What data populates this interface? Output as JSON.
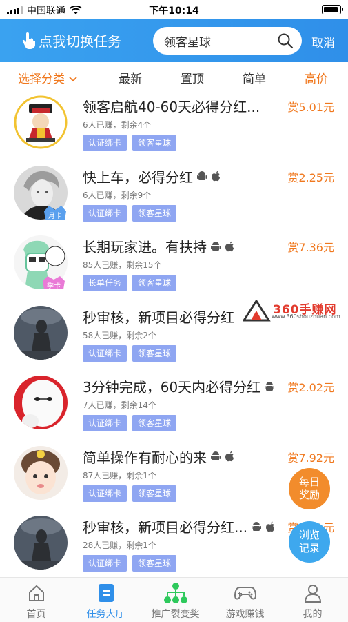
{
  "status_bar": {
    "carrier": "中国联通",
    "time": "下午10:14"
  },
  "header": {
    "switch_label": "点我切换任务",
    "search_value": "领客星球",
    "cancel_label": "取消"
  },
  "filters": {
    "category": "选择分类",
    "latest": "最新",
    "pinned": "置顶",
    "simple": "简单",
    "high_price": "高价"
  },
  "tasks": [
    {
      "title": "领客启航40-60天必得分红...",
      "reward": "赏5.01元",
      "meta": "6人已赚，剩余4个",
      "tags": [
        "认证绑卡",
        "领客星球"
      ],
      "badge": ""
    },
    {
      "title": "快上车，必得分红",
      "reward": "赏2.25元",
      "meta": "6人已赚，剩余9个",
      "tags": [
        "认证绑卡",
        "领客星球"
      ],
      "badge": "月卡"
    },
    {
      "title": "长期玩家进。有扶持",
      "reward": "赏7.36元",
      "meta": "85人已赚，剩余15个",
      "tags": [
        "长单任务",
        "领客星球"
      ],
      "badge": "季卡"
    },
    {
      "title": "秒审核，新项目必得分红",
      "reward": "",
      "meta": "58人已赚，剩余2个",
      "tags": [
        "认证绑卡",
        "领客星球"
      ],
      "badge": ""
    },
    {
      "title": "3分钟完成，60天内必得分红",
      "reward": "赏2.02元",
      "meta": "7人已赚，剩余14个",
      "tags": [
        "认证绑卡",
        "领客星球"
      ],
      "badge": ""
    },
    {
      "title": "简单操作有耐心的来",
      "reward": "赏7.92元",
      "meta": "87人已赚，剩余1个",
      "tags": [
        "认证绑卡",
        "领客星球"
      ],
      "badge": ""
    },
    {
      "title": "秒审核，新项目必得分红...",
      "reward": "赏5.01元",
      "meta": "28人已赚，剩余1个",
      "tags": [
        "认证绑卡",
        "领客星球"
      ],
      "badge": ""
    }
  ],
  "floating": {
    "daily": [
      "每日",
      "奖励"
    ],
    "history": [
      "浏览",
      "记录"
    ]
  },
  "watermark": {
    "title": "360手赚网",
    "url": "www.360shouzhuan.com"
  },
  "bottom_nav": [
    {
      "label": "首页",
      "icon": "home-icon"
    },
    {
      "label": "任务大厅",
      "icon": "task-hall-icon"
    },
    {
      "label": "推广裂变奖",
      "icon": "network-icon"
    },
    {
      "label": "游戏赚钱",
      "icon": "gamepad-icon"
    },
    {
      "label": "我的",
      "icon": "user-icon"
    }
  ],
  "colors": {
    "header_blue": "#3aa2f0",
    "accent_orange": "#f0781e",
    "tag_blue": "#8fa6f2",
    "nav_active": "#2f8fe9"
  }
}
